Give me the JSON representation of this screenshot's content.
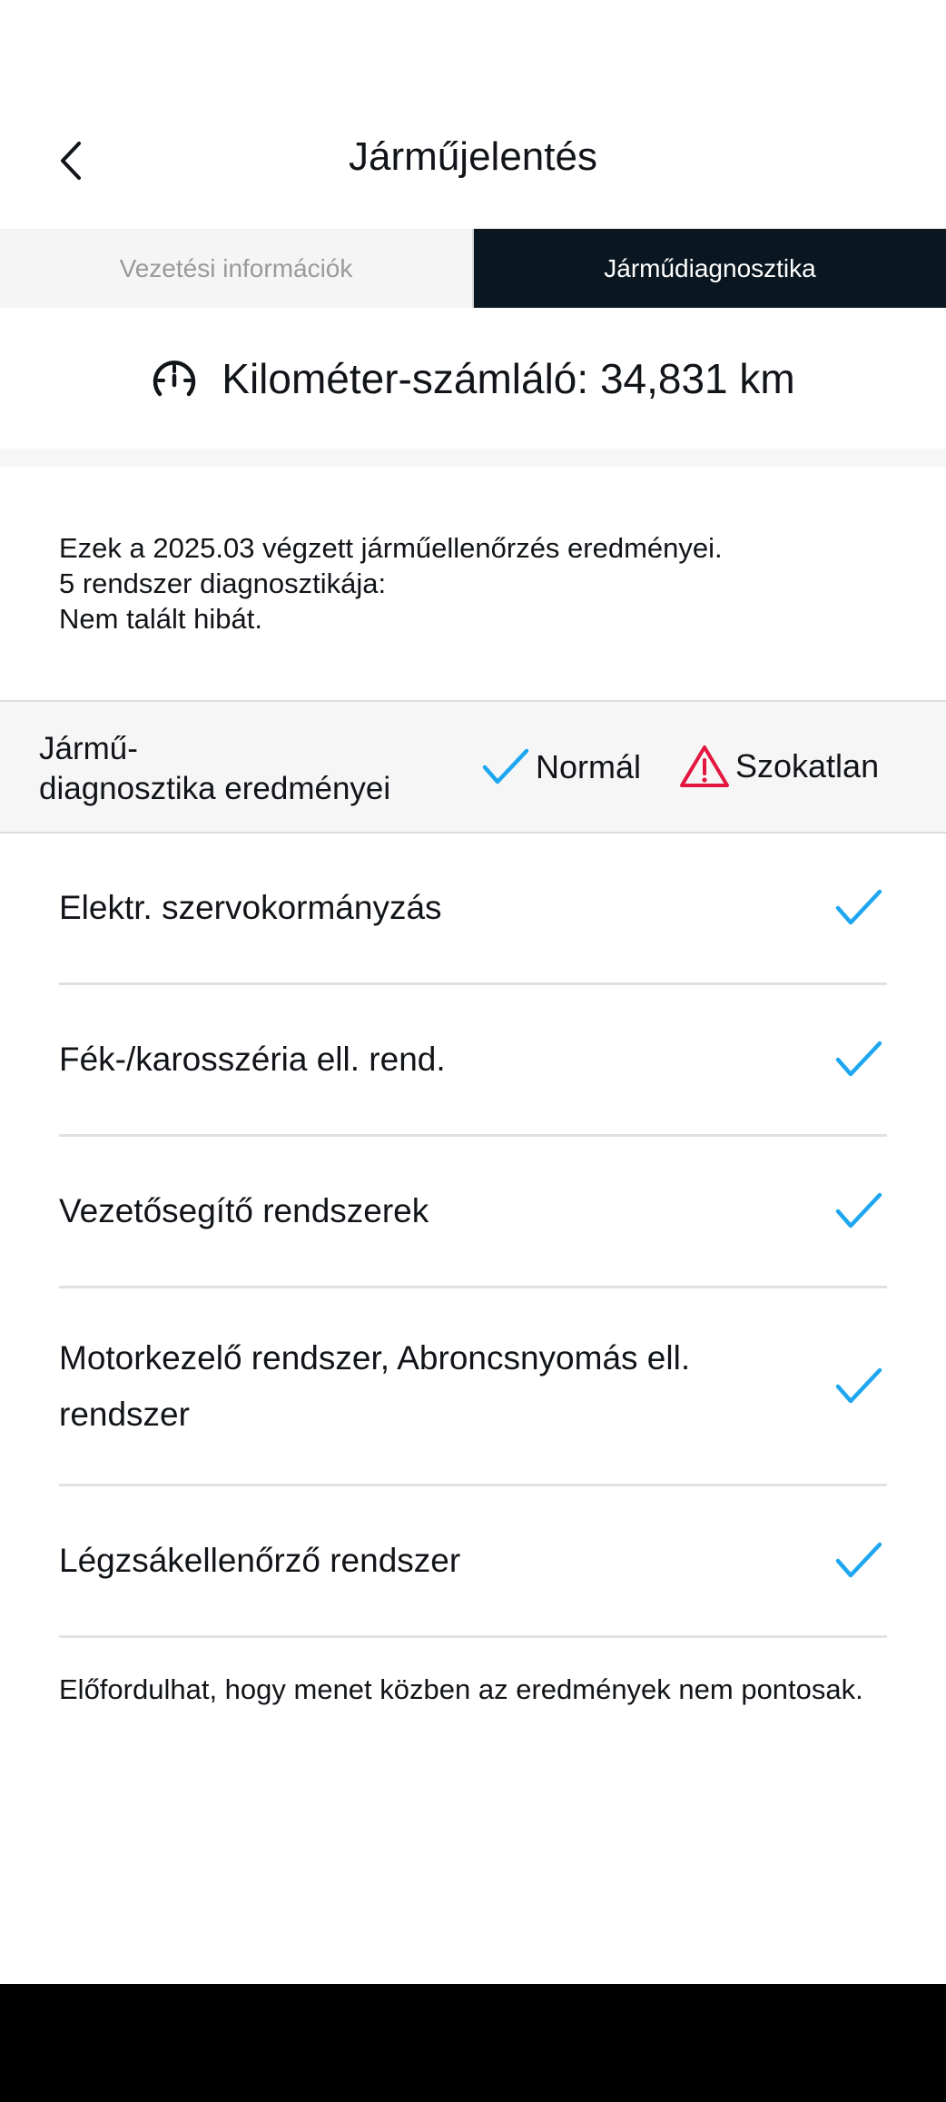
{
  "header": {
    "title": "Járműjelentés"
  },
  "tabs": [
    {
      "label": "Vezetési információk",
      "active": false
    },
    {
      "label": "Járműdiagnosztika",
      "active": true
    }
  ],
  "odometer": {
    "text": "Kilométer-számláló: 34,831 km",
    "icon": "speedometer-icon"
  },
  "summary": {
    "line1": "Ezek a 2025.03 végzett járműellenőrzés eredményei.",
    "line2": "5 rendszer diagnosztikája:",
    "line3": "Nem talált hibát."
  },
  "results_header": {
    "title_line1": "Jármű-",
    "title_line2": "diagnosztika eredményei",
    "normal_label": "Normál",
    "unusual_label": "Szokatlan"
  },
  "systems": [
    {
      "name": "Elektr. szervokormányzás",
      "status": "normal"
    },
    {
      "name": "Fék-/karosszéria ell. rend.",
      "status": "normal"
    },
    {
      "name": "Vezetősegítő rendszerek",
      "status": "normal"
    },
    {
      "name": "Motorkezelő rendszer, Abroncsnyomás ell. rendszer",
      "status": "normal"
    },
    {
      "name": "Légzsákellenőrző rendszer",
      "status": "normal"
    }
  ],
  "footnote": "Előfordulhat, hogy menet közben az eredmények nem pontosak.",
  "colors": {
    "accent_check": "#1ea7f0",
    "warning": "#e3173f",
    "active_tab": "#0b1720"
  }
}
